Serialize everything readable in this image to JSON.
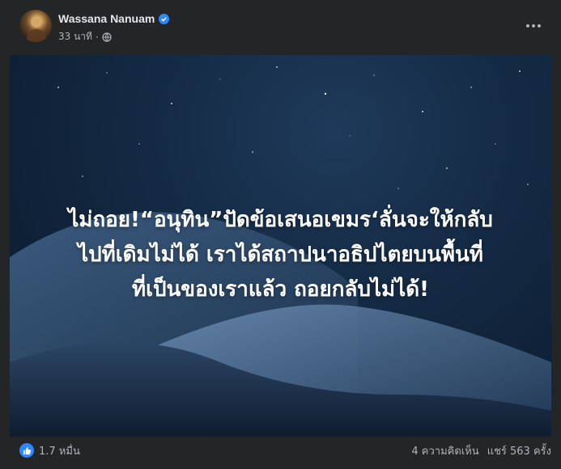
{
  "post": {
    "author": "Wassana Nanuam",
    "timestamp": "33 นาที",
    "privacy_icon": "globe-icon",
    "headline_lines": [
      "ไม่ถอย!“อนุทิน”ปัดข้อเสนอเขมร‘ลั่นจะให้กลับ",
      "ไปที่เดิมไม่ได้ เราได้สถาปนาอธิปไตยบนพื้นที่",
      "ที่เป็นของเราแล้ว ถอยกลับไม่ได้!"
    ],
    "reaction_count": "1.7 หมื่น",
    "comments": "4 ความคิดเห็น",
    "shares": "แชร์ 563 ครั้ง"
  },
  "colors": {
    "background": "#242526",
    "accent": "#2d88ff",
    "text": "#e4e6eb",
    "muted": "#b0b3b8"
  }
}
